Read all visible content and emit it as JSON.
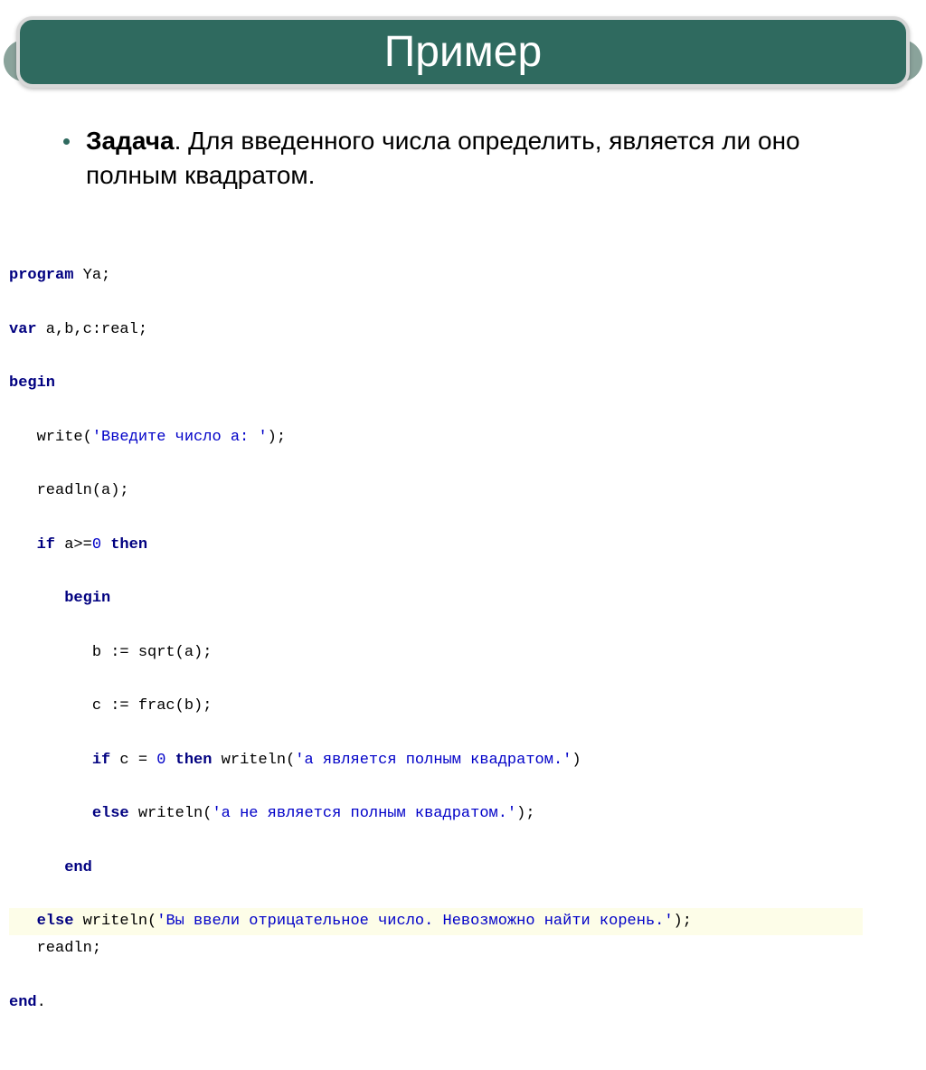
{
  "title": "Пример",
  "task": {
    "label": "Задача",
    "text": ". Для введенного числа определить, является ли оно полным квадратом."
  },
  "code": {
    "l1_kw": "program",
    "l1_id": " Ya;",
    "l2_kw": "var",
    "l2_id": " a,b,c:real;",
    "l3_kw": "begin",
    "l4_id": "   write(",
    "l4_str": "'Введите число a: '",
    "l4_end": ");",
    "l5_id": "   readln(a);",
    "l6_pre": "   ",
    "l6_kw": "if",
    "l6_mid": " a>=",
    "l6_num": "0",
    "l6_sp": " ",
    "l6_kw2": "then",
    "l7_pre": "      ",
    "l7_kw": "begin",
    "l8_id": "         b := sqrt(a);",
    "l9_id": "         c := frac(b);",
    "l10_pre": "         ",
    "l10_kw": "if",
    "l10_mid": " c = ",
    "l10_num": "0",
    "l10_sp": " ",
    "l10_kw2": "then",
    "l10_call": " writeln(",
    "l10_str": "'a является полным квадратом.'",
    "l10_end": ")",
    "l11_pre": "         ",
    "l11_kw": "else",
    "l11_call": " writeln(",
    "l11_str": "'a не является полным квадратом.'",
    "l11_end": ");",
    "l12_pre": "      ",
    "l12_kw": "end",
    "l13_pre": "   ",
    "l13_kw": "else",
    "l13_call": " writeln(",
    "l13_str": "'Вы ввели отрицательное число. Невозможно найти корень.'",
    "l13_end": ");",
    "l14_id": "   readln;",
    "l15_kw": "end",
    "l15_end": "."
  }
}
